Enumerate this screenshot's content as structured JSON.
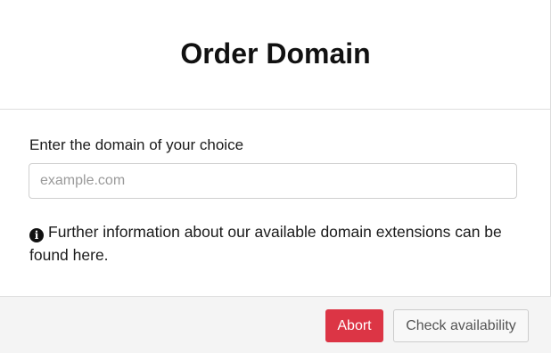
{
  "modal": {
    "title": "Order Domain"
  },
  "form": {
    "label": "Enter the domain of your choice",
    "input_value": "",
    "input_placeholder": "example.com"
  },
  "info": {
    "icon": "info-circle-icon",
    "text": "Further information about our available domain extensions can be found here."
  },
  "footer": {
    "abort_label": "Abort",
    "check_label": "Check availability"
  },
  "colors": {
    "abort_bg": "#dc3545",
    "footer_bg": "#f4f4f4"
  }
}
